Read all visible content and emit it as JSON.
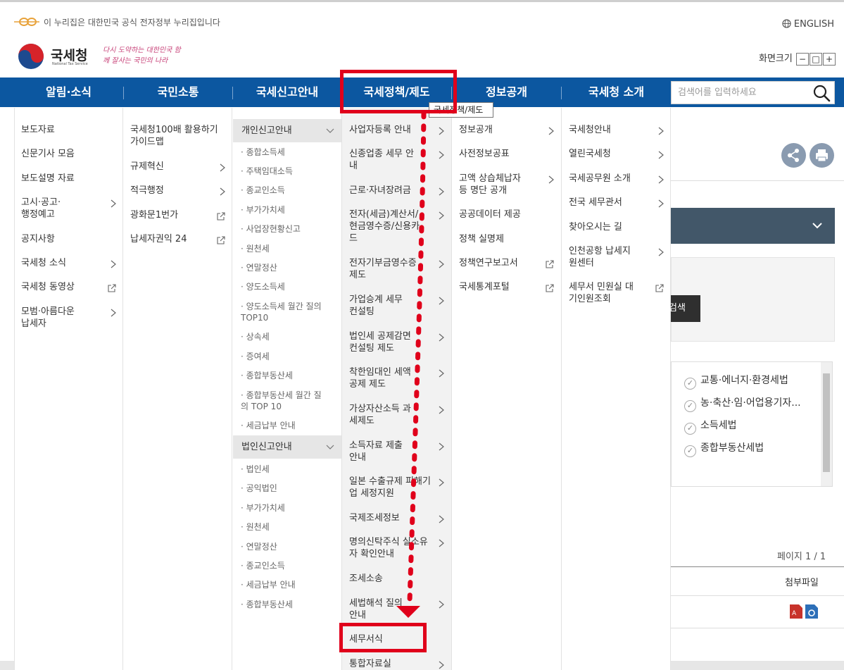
{
  "header": {
    "gov_notice": "이 누리집은 대한민국 공식 전자정부 누리집입니다",
    "english": "ENGLISH",
    "org_name": "국세청",
    "org_sub": "National Tax Service",
    "slogan": "다시 도약하는 대한민국 함께 잘사는 국민의 나라",
    "font_size_label": "화면크기",
    "font_minus": "−",
    "font_reset": "□",
    "font_plus": "+"
  },
  "nav": {
    "items": [
      "알림·소식",
      "국민소통",
      "국세신고안내",
      "국세정책/제도",
      "정보공개",
      "국세청 소개"
    ],
    "search_placeholder": "검색어를 입력하세요"
  },
  "tooltip": "국세정책/제도",
  "menu": {
    "col1": [
      {
        "label": "보도자료"
      },
      {
        "label": "신문기사 모음"
      },
      {
        "label": "보도설명 자료"
      },
      {
        "label": "고시·공고·행정예고"
      },
      {
        "label": "공지사항"
      },
      {
        "label": "국세청 소식"
      },
      {
        "label": "국세청 동영상"
      },
      {
        "label": "모범·아름다운 납세자"
      }
    ],
    "col2": [
      {
        "label": "국세청100배 활용하기 가이드맵"
      },
      {
        "label": "규제혁신"
      },
      {
        "label": "적극행정"
      },
      {
        "label": "광화문1번가"
      },
      {
        "label": "납세자권익 24"
      }
    ],
    "col3": {
      "personal": "개인신고안내",
      "personal_items": [
        "종합소득세",
        "주택임대소득",
        "종교인소득",
        "부가가치세",
        "사업장현황신고",
        "원천세",
        "연말정산",
        "양도소득세",
        "양도소득세 월간 질의 TOP10",
        "상속세",
        "증여세",
        "종합부동산세",
        "종합부동산세 월간 질의 TOP 10",
        "세금납부 안내"
      ],
      "corporate": "법인신고안내",
      "corporate_items": [
        "법인세",
        "공익법인",
        "부가가치세",
        "원천세",
        "연말정산",
        "종교인소득",
        "세금납부 안내",
        "종합부동산세"
      ]
    },
    "col4": [
      {
        "label": "사업자등록 안내"
      },
      {
        "label": "신종업종 세무 안내"
      },
      {
        "label": "근로·자녀장려금"
      },
      {
        "label": "전자(세금)계산서/현금영수증/신용카드"
      },
      {
        "label": "전자기부금영수증 제도"
      },
      {
        "label": "가업승계 세무컨설팅"
      },
      {
        "label": "법인세 공제감면 컨설팅 제도"
      },
      {
        "label": "착한임대인 세액공제 제도"
      },
      {
        "label": "가상자산소득 과세제도"
      },
      {
        "label": "소득자료 제출 안내"
      },
      {
        "label": "일본 수출규제 피해기업 세정지원"
      },
      {
        "label": "국제조세정보"
      },
      {
        "label": "명의신탁주식 실소유자 확인안내"
      },
      {
        "label": "조세소송"
      },
      {
        "label": "세법해석 질의 안내"
      },
      {
        "label": "세무서식"
      },
      {
        "label": "통합자료실"
      }
    ],
    "col5": [
      {
        "label": "정보공개"
      },
      {
        "label": "사전정보공표"
      },
      {
        "label": "고액 상습체납자 등 명단 공개"
      },
      {
        "label": "공공데이터 제공"
      },
      {
        "label": "정책 실명제"
      },
      {
        "label": "정책연구보고서"
      },
      {
        "label": "국세통계포털"
      }
    ],
    "col6": [
      {
        "label": "국세청안내"
      },
      {
        "label": "열린국세청"
      },
      {
        "label": "국세공무원 소개"
      },
      {
        "label": "전국 세무관서"
      },
      {
        "label": "찾아오시는 길"
      },
      {
        "label": "인천공항 납세지원센터"
      },
      {
        "label": "세무서 민원실 대기인원조회"
      }
    ]
  },
  "bg": {
    "search_btn": "검색",
    "checks": [
      "교통·에너지·환경세법",
      "농·축산·임·어업용기자...",
      "소득세법",
      "종합부동산세법"
    ],
    "page_info": "페이지 1 / 1",
    "attach": "첨부파일"
  },
  "colors": {
    "nav": "#0c57a0",
    "annotation": "#e0001b",
    "dark_bar": "#425769"
  }
}
